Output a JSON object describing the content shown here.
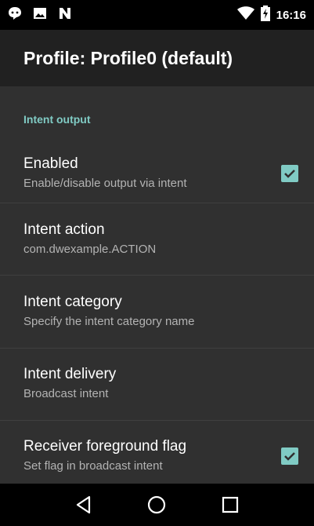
{
  "status_bar": {
    "time": "16:16",
    "icons": [
      "chat-bubble-icon",
      "image-icon",
      "n-notification-icon",
      "wifi-icon",
      "battery-charging-icon"
    ]
  },
  "app_bar": {
    "title": "Profile: Profile0 (default)"
  },
  "section": {
    "header": "Intent output"
  },
  "preferences": [
    {
      "title": "Enabled",
      "summary": "Enable/disable output via intent",
      "checked": true
    },
    {
      "title": "Intent action",
      "summary": "com.dwexample.ACTION"
    },
    {
      "title": "Intent category",
      "summary": "Specify the intent category name"
    },
    {
      "title": "Intent delivery",
      "summary": "Broadcast intent"
    },
    {
      "title": "Receiver foreground flag",
      "summary": "Set flag in broadcast intent",
      "checked": true
    }
  ],
  "nav_bar": {
    "icons": [
      "back-icon",
      "home-icon",
      "recents-icon"
    ]
  },
  "colors": {
    "accent": "#80CBC4",
    "background": "#303030",
    "app_bar": "#212121"
  }
}
